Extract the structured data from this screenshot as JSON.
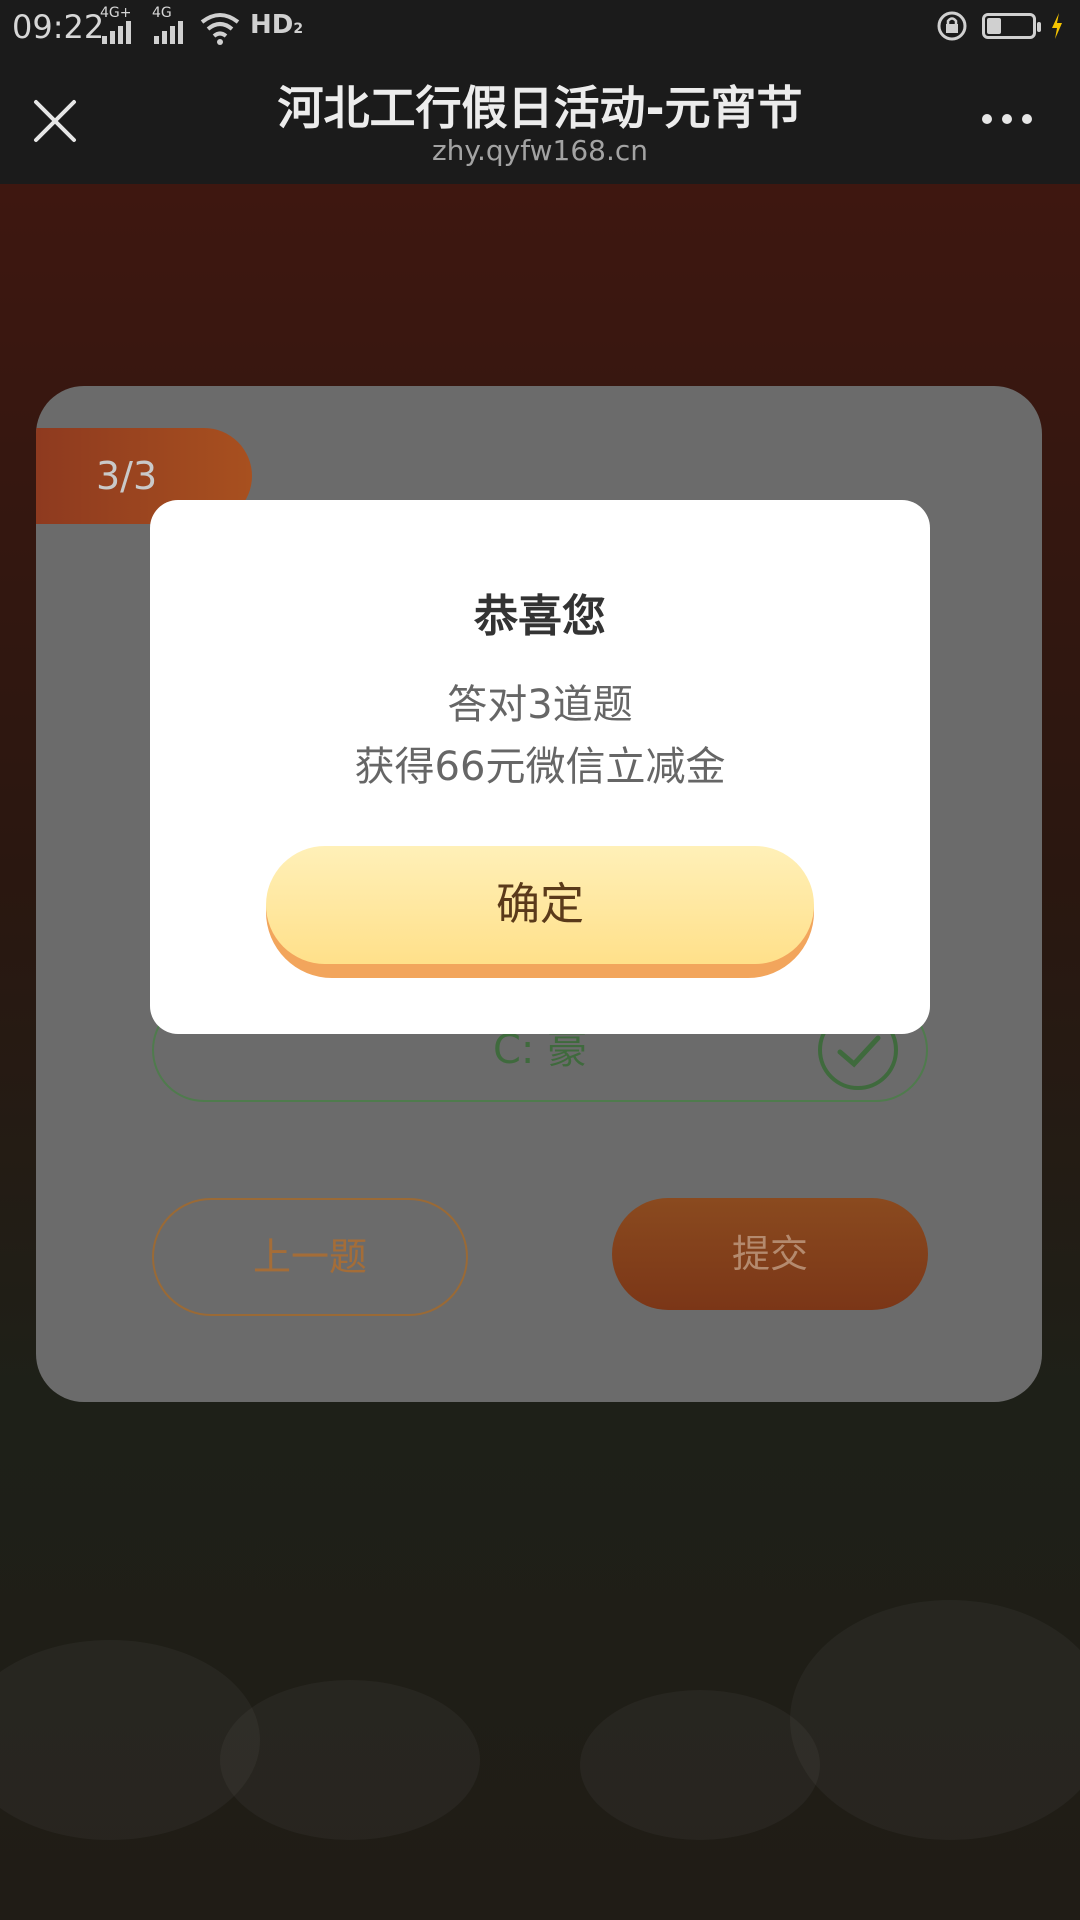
{
  "status_bar": {
    "time": "09:22",
    "network1": "4G+",
    "network2": "4G",
    "hd_label": "HD",
    "hd_sub": "2"
  },
  "header": {
    "title": "河北工行假日活动-元宵节",
    "url": "zhy.qyfw168.cn"
  },
  "quiz": {
    "progress": "3/3",
    "option_c": "C:  豪",
    "prev_label": "上一题",
    "submit_label": "提交"
  },
  "modal": {
    "title": "恭喜您",
    "line1": "答对3道题",
    "line2": "获得66元微信立减金",
    "confirm_label": "确定"
  },
  "colors": {
    "accent_orange": "#f2a55c",
    "button_yellow": "#ffe08a",
    "correct_green": "#3f6a3d"
  }
}
